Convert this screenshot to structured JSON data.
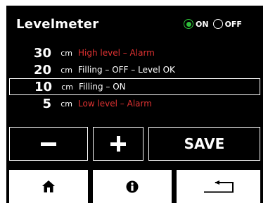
{
  "header": {
    "title": "Levelmeter",
    "radio_on_label": "ON",
    "radio_off_label": "OFF",
    "selected": "ON"
  },
  "levels": [
    {
      "value": "30",
      "unit": "cm",
      "description": "High level – Alarm",
      "alarm": true
    },
    {
      "value": "20",
      "unit": "cm",
      "description": "Filling – OFF – Level OK",
      "alarm": false
    },
    {
      "value": "10",
      "unit": "cm",
      "description": "Filling – ON",
      "alarm": false,
      "selected": true
    },
    {
      "value": "5",
      "unit": "cm",
      "description": "Low level – Alarm",
      "alarm": true
    }
  ],
  "controls": {
    "minus_icon": "minus-icon",
    "plus_icon": "plus-icon",
    "save_label": "SAVE"
  },
  "nav": {
    "home_icon": "home-icon",
    "info_icon": "info-icon",
    "back_icon": "return-icon"
  },
  "colors": {
    "background": "#000000",
    "text": "#ffffff",
    "alarm": "#e03232",
    "radio_active": "#2fbf3a"
  }
}
